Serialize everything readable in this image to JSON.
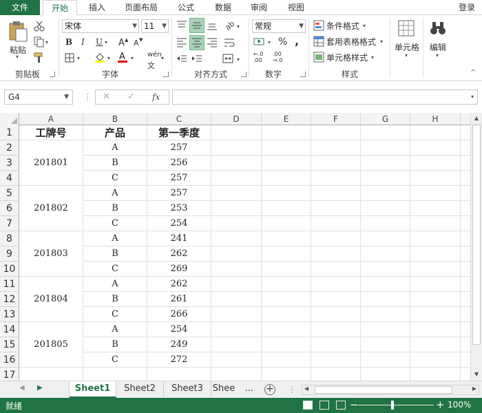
{
  "ribbon_tabs": {
    "file": "文件",
    "home": "开始",
    "insert": "插入",
    "page_layout": "页面布局",
    "formulas": "公式",
    "data": "数据",
    "review": "审阅",
    "view": "视图",
    "login": "登录"
  },
  "ribbon": {
    "clipboard": {
      "paste": "粘贴",
      "label": "剪贴板"
    },
    "font": {
      "name": "宋体",
      "size": "11",
      "bold": "B",
      "italic": "I",
      "underline": "U",
      "label": "字体",
      "phonetic": "wén"
    },
    "alignment": {
      "label": "对齐方式"
    },
    "number": {
      "format": "常规",
      "percent": "%",
      "comma": ",",
      "label": "数字"
    },
    "styles": {
      "conditional": "条件格式",
      "table": "套用表格格式",
      "cell_styles": "单元格样式",
      "label": "样式"
    },
    "cells": {
      "label": "单元格"
    },
    "editing": {
      "label": "编辑"
    }
  },
  "formula_bar": {
    "name_box": "G4",
    "formula": ""
  },
  "columns": [
    "A",
    "B",
    "C",
    "D",
    "E",
    "F",
    "G",
    "H"
  ],
  "rows": [
    "1",
    "2",
    "3",
    "4",
    "5",
    "6",
    "7",
    "8",
    "9",
    "10",
    "11",
    "12",
    "13",
    "14",
    "15",
    "16",
    "17"
  ],
  "table": {
    "headers": [
      "工牌号",
      "产品",
      "第一季度"
    ],
    "groups": [
      {
        "id": "201801",
        "rows": [
          [
            "A",
            "257"
          ],
          [
            "B",
            "256"
          ],
          [
            "C",
            "257"
          ]
        ]
      },
      {
        "id": "201802",
        "rows": [
          [
            "A",
            "257"
          ],
          [
            "B",
            "253"
          ],
          [
            "C",
            "254"
          ]
        ]
      },
      {
        "id": "201803",
        "rows": [
          [
            "A",
            "241"
          ],
          [
            "B",
            "262"
          ],
          [
            "C",
            "269"
          ]
        ]
      },
      {
        "id": "201804",
        "rows": [
          [
            "A",
            "262"
          ],
          [
            "B",
            "261"
          ],
          [
            "C",
            "266"
          ]
        ]
      },
      {
        "id": "201805",
        "rows": [
          [
            "A",
            "254"
          ],
          [
            "B",
            "249"
          ],
          [
            "C",
            "272"
          ]
        ]
      }
    ]
  },
  "sheets": [
    "Sheet1",
    "Sheet2",
    "Sheet3",
    "Shee"
  ],
  "sheet_more": "...",
  "status": {
    "ready": "就绪",
    "zoom": "100%"
  },
  "colors": {
    "accent": "#217346"
  }
}
